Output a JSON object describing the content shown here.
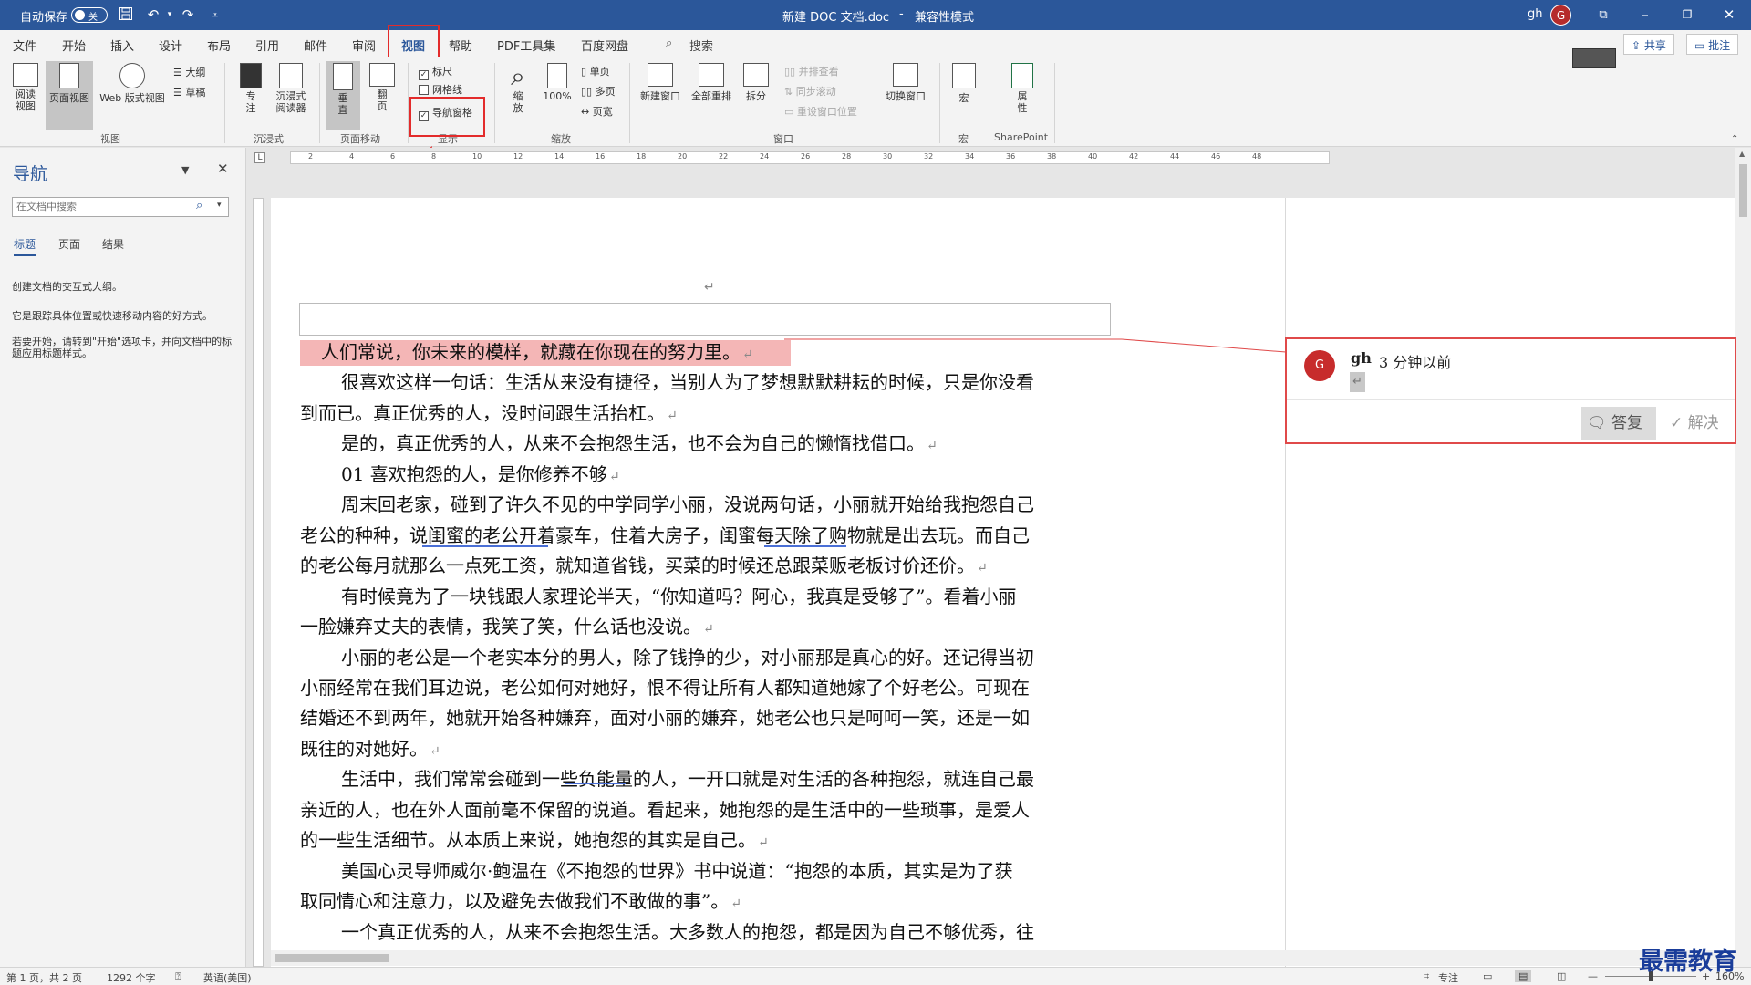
{
  "titlebar": {
    "autosave_label": "自动保存",
    "autosave_state": "关",
    "doc_title": "新建 DOC 文档.doc",
    "mode_sep": "-",
    "mode": "兼容性模式",
    "user": "gh",
    "avatar": "G"
  },
  "tabs": [
    "文件",
    "开始",
    "插入",
    "设计",
    "布局",
    "引用",
    "邮件",
    "审阅",
    "视图",
    "帮助",
    "PDF工具集",
    "百度网盘"
  ],
  "search_label": "搜索",
  "share_label": "共享",
  "comment_label": "批注",
  "ribbon": {
    "view": {
      "read": "阅读\n视图",
      "print": "页面视图",
      "web": "Web 版式视图",
      "outline": "大纲",
      "draft": "草稿",
      "group": "视图"
    },
    "immersive": {
      "focus": "专\n注",
      "reader": "沉浸式\n阅读器",
      "group": "沉浸式"
    },
    "pagemove": {
      "vertical": "垂\n直",
      "side": "翻\n页",
      "group": "页面移动"
    },
    "show": {
      "ruler": "标尺",
      "grid": "网格线",
      "nav": "导航窗格",
      "group": "显示"
    },
    "zoom": {
      "zoom": "缩\n放",
      "pct": "100%",
      "one": "单页",
      "multi": "多页",
      "width": "页宽",
      "group": "缩放"
    },
    "window": {
      "new": "新建窗口",
      "arrange": "全部重排",
      "split": "拆分",
      "side": "并排查看",
      "sync": "同步滚动",
      "reset": "重设窗口位置",
      "switch": "切换窗口",
      "group": "窗口"
    },
    "macro": {
      "macro": "宏",
      "group": "宏"
    },
    "sharepoint": {
      "props": "属\n性",
      "group": "SharePoint"
    }
  },
  "nav": {
    "title": "导航",
    "search_placeholder": "在文档中搜索",
    "tabs": [
      "标题",
      "页面",
      "结果"
    ],
    "line1": "创建文档的交互式大纲。",
    "line2": "它是跟踪具体位置或快速移动内容的好方式。",
    "line3": "若要开始，请转到\"开始\"选项卡，并向文档中的标题应用标题样式。"
  },
  "ruler_numbers": [
    "2",
    "4",
    "6",
    "8",
    "10",
    "12",
    "14",
    "16",
    "18",
    "20",
    "22",
    "24",
    "26",
    "28",
    "30",
    "32",
    "34",
    "36",
    "38",
    "40",
    "42",
    "44",
    "46",
    "48"
  ],
  "doc": {
    "lines": [
      "人们常说，你未来的模样，就藏在你现在的努力里。",
      "很喜欢这样一句话：生活从来没有捷径，当别人为了梦想默默耕耘的时候，只是你没看",
      "到而已。真正优秀的人，没时间跟生活抬杠。",
      "是的，真正优秀的人，从来不会抱怨生活，也不会为自己的懒惰找借口。",
      "01  喜欢抱怨的人，是你修养不够",
      "周末回老家，碰到了许久不见的中学同学小丽，没说两句话，小丽就开始给我抱怨自己",
      "老公的种种，说闺蜜的老公开着豪车，住着大房子，闺蜜每天除了购物就是出去玩。而自己",
      "的老公每月就那么一点死工资，就知道省钱，买菜的时候还总跟菜贩老板讨价还价。",
      "有时候竟为了一块钱跟人家理论半天，“你知道吗？阿心，我真是受够了”。看着小丽",
      "一脸嫌弃丈夫的表情，我笑了笑，什么话也没说。",
      "小丽的老公是一个老实本分的男人，除了钱挣的少，对小丽那是真心的好。还记得当初",
      "小丽经常在我们耳边说，老公如何对她好，恨不得让所有人都知道她嫁了个好老公。可现在",
      "结婚还不到两年，她就开始各种嫌弃，面对小丽的嫌弃，她老公也只是呵呵一笑，还是一如",
      "既往的对她好。",
      "生活中，我们常常会碰到一些负能量的人，一开口就是对生活的各种抱怨，就连自己最",
      "亲近的人，也在外人面前毫不保留的说道。看起来，她抱怨的是生活中的一些琐事，是爱人",
      "的一些生活细节。从本质上来说，她抱怨的其实是自己。",
      "美国心灵导师威尔·鲍温在《不抱怨的世界》书中说道：“抱怨的本质，其实是为了获",
      "取同情心和注意力，以及避免去做我们不敢做的事”。",
      "一个真正优秀的人，从来不会抱怨生活。大多数人的抱怨，都是因为自己不够优秀，往"
    ],
    "para_mark": "↵"
  },
  "comment": {
    "avatar": "G",
    "author": "gh",
    "time": "3 分钟以前",
    "reply": "答复",
    "resolve": "解决"
  },
  "status": {
    "page": "第 1 页，共 2 页",
    "words": "1292 个字",
    "lang": "英语(美国)",
    "focus": "专注",
    "zoom": "160%",
    "minus": "—",
    "plus": "+"
  },
  "watermark": "最需教育"
}
